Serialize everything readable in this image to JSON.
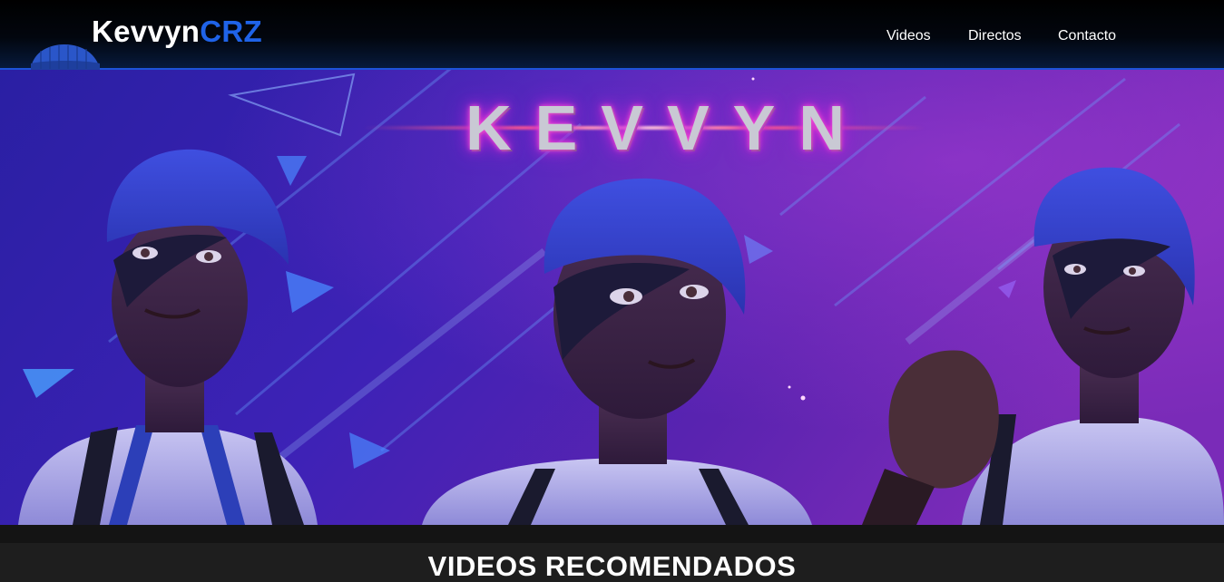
{
  "header": {
    "brand_part1": "Kevvyn",
    "brand_part2": "CRZ",
    "logo_icon": "beanie-icon",
    "nav": {
      "videos": "Videos",
      "directos": "Directos",
      "contacto": "Contacto"
    }
  },
  "hero": {
    "title": "KEVVYN",
    "image": "three-character-artwork"
  },
  "section": {
    "title": "VIDEOS RECOMENDADOS"
  },
  "colors": {
    "accent_blue": "#1f63e8",
    "header_border": "#1d53d8",
    "hero_left": "#2a1fa3",
    "hero_right": "#7a2bb8",
    "page_background": "#1e1e1e"
  }
}
